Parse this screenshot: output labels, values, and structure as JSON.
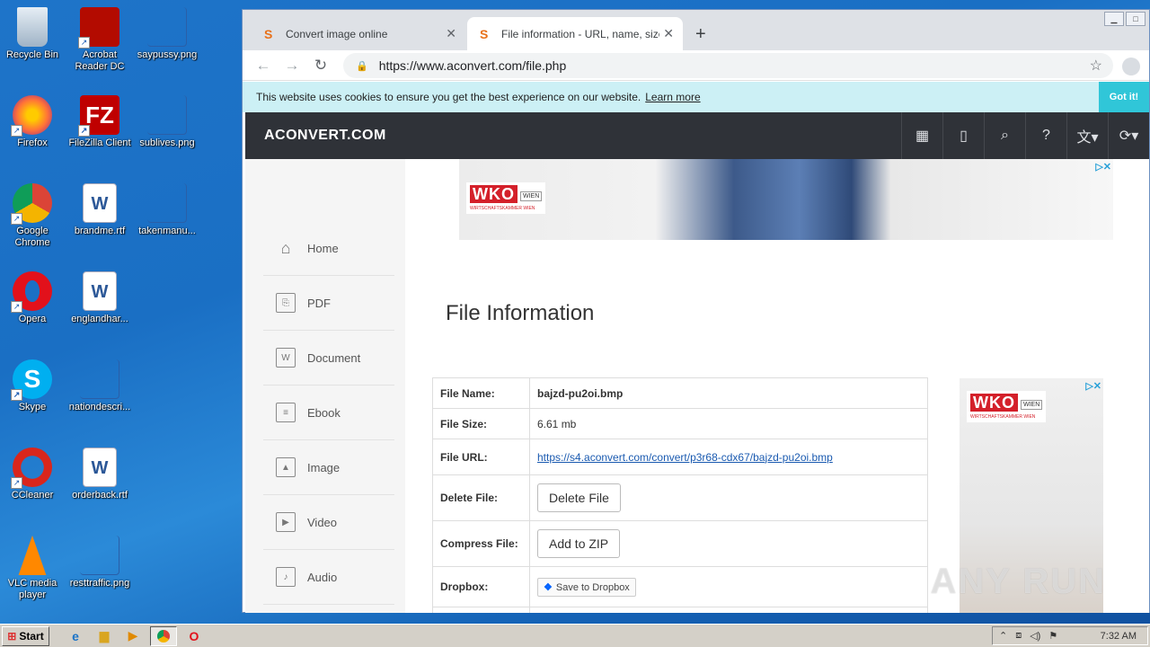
{
  "desktop": {
    "icons": [
      {
        "label": "Recycle Bin"
      },
      {
        "label": "Acrobat Reader DC"
      },
      {
        "label": "saypussy.png"
      },
      {
        "label": "Firefox"
      },
      {
        "label": "FileZilla Client"
      },
      {
        "label": "sublives.png"
      },
      {
        "label": "Google Chrome"
      },
      {
        "label": "brandme.rtf"
      },
      {
        "label": "takenmanu..."
      },
      {
        "label": "Opera"
      },
      {
        "label": "englandhar..."
      },
      {
        "label": "Skype"
      },
      {
        "label": "nationdescri..."
      },
      {
        "label": "CCleaner"
      },
      {
        "label": "orderback.rtf"
      },
      {
        "label": "VLC media player"
      },
      {
        "label": "resttraffic.png"
      }
    ]
  },
  "browser": {
    "tabs": [
      {
        "title": "Convert image online"
      },
      {
        "title": "File information - URL, name, size and"
      }
    ],
    "url": "https://www.aconvert.com/file.php"
  },
  "cookie": {
    "text": "This website uses cookies to ensure you get the best experience on our website.",
    "learn_more": "Learn more",
    "got_it": "Got it!"
  },
  "site": {
    "logo": "ACONVERT.COM",
    "sidebar": [
      {
        "label": "Home"
      },
      {
        "label": "PDF"
      },
      {
        "label": "Document"
      },
      {
        "label": "Ebook"
      },
      {
        "label": "Image"
      },
      {
        "label": "Video"
      },
      {
        "label": "Audio"
      }
    ],
    "ad_brand": "WKO",
    "ad_wien": "WIEN",
    "ad_sub": "WIRTSCHAFTSKAMMER WIEN",
    "page_title": "File Information",
    "file_info": {
      "name_label": "File Name:",
      "name": "bajzd-pu2oi.bmp",
      "size_label": "File Size:",
      "size": "6.61 mb",
      "url_label": "File URL:",
      "url": "https://s4.aconvert.com/convert/p3r68-cdx67/bajzd-pu2oi.bmp",
      "delete_label": "Delete File:",
      "delete_button": "Delete File",
      "compress_label": "Compress File:",
      "compress_button": "Add to ZIP",
      "dropbox_label": "Dropbox:",
      "dropbox_button": "Save to Dropbox"
    }
  },
  "watermark": "ANY RUN",
  "taskbar": {
    "start": "Start",
    "clock": "7:32 AM"
  }
}
